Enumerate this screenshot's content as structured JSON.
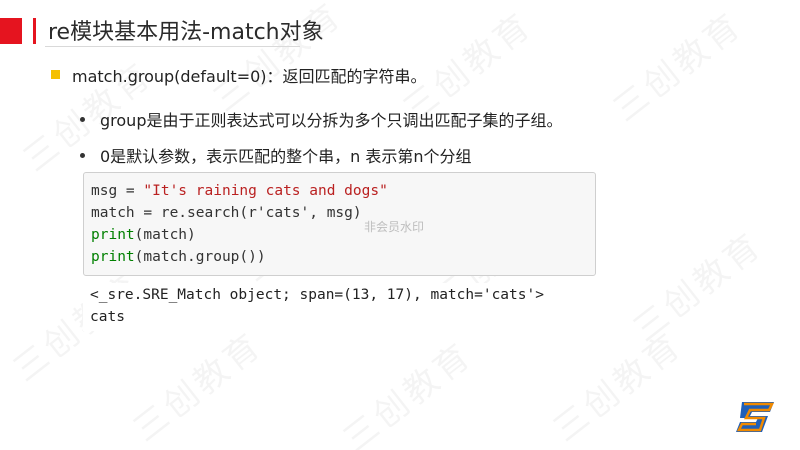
{
  "slide": {
    "title": "re模块基本用法-match对象",
    "main_point": "match.group(default=0)：返回匹配的字符串。",
    "sub_points": [
      "group是由于正则表达式可以分拆为多个只调出匹配子集的子组。",
      "0是默认参数，表示匹配的整个串，n 表示第n个分组"
    ]
  },
  "code": {
    "line1_a": "msg = ",
    "line1_str": "\"It's raining cats and dogs\"",
    "line2_a": "match = re.search(r'cats', msg)",
    "line3_kw": "print",
    "line3_b": "(match)",
    "line4_kw": "print",
    "line4_b": "(match.group())"
  },
  "output": {
    "line1": "<_sre.SRE_Match object; span=(13, 17), match='cats'>",
    "line2": "cats"
  },
  "overlay": {
    "member_watermark": "非会员水印",
    "brand_watermark": "三创教育"
  },
  "colors": {
    "accent_red": "#e5141f",
    "bullet_yellow": "#f5c000",
    "keyword_green": "#008000",
    "string_red": "#ba2121"
  },
  "icons": {
    "logo": "sanchuang-s-logo"
  }
}
